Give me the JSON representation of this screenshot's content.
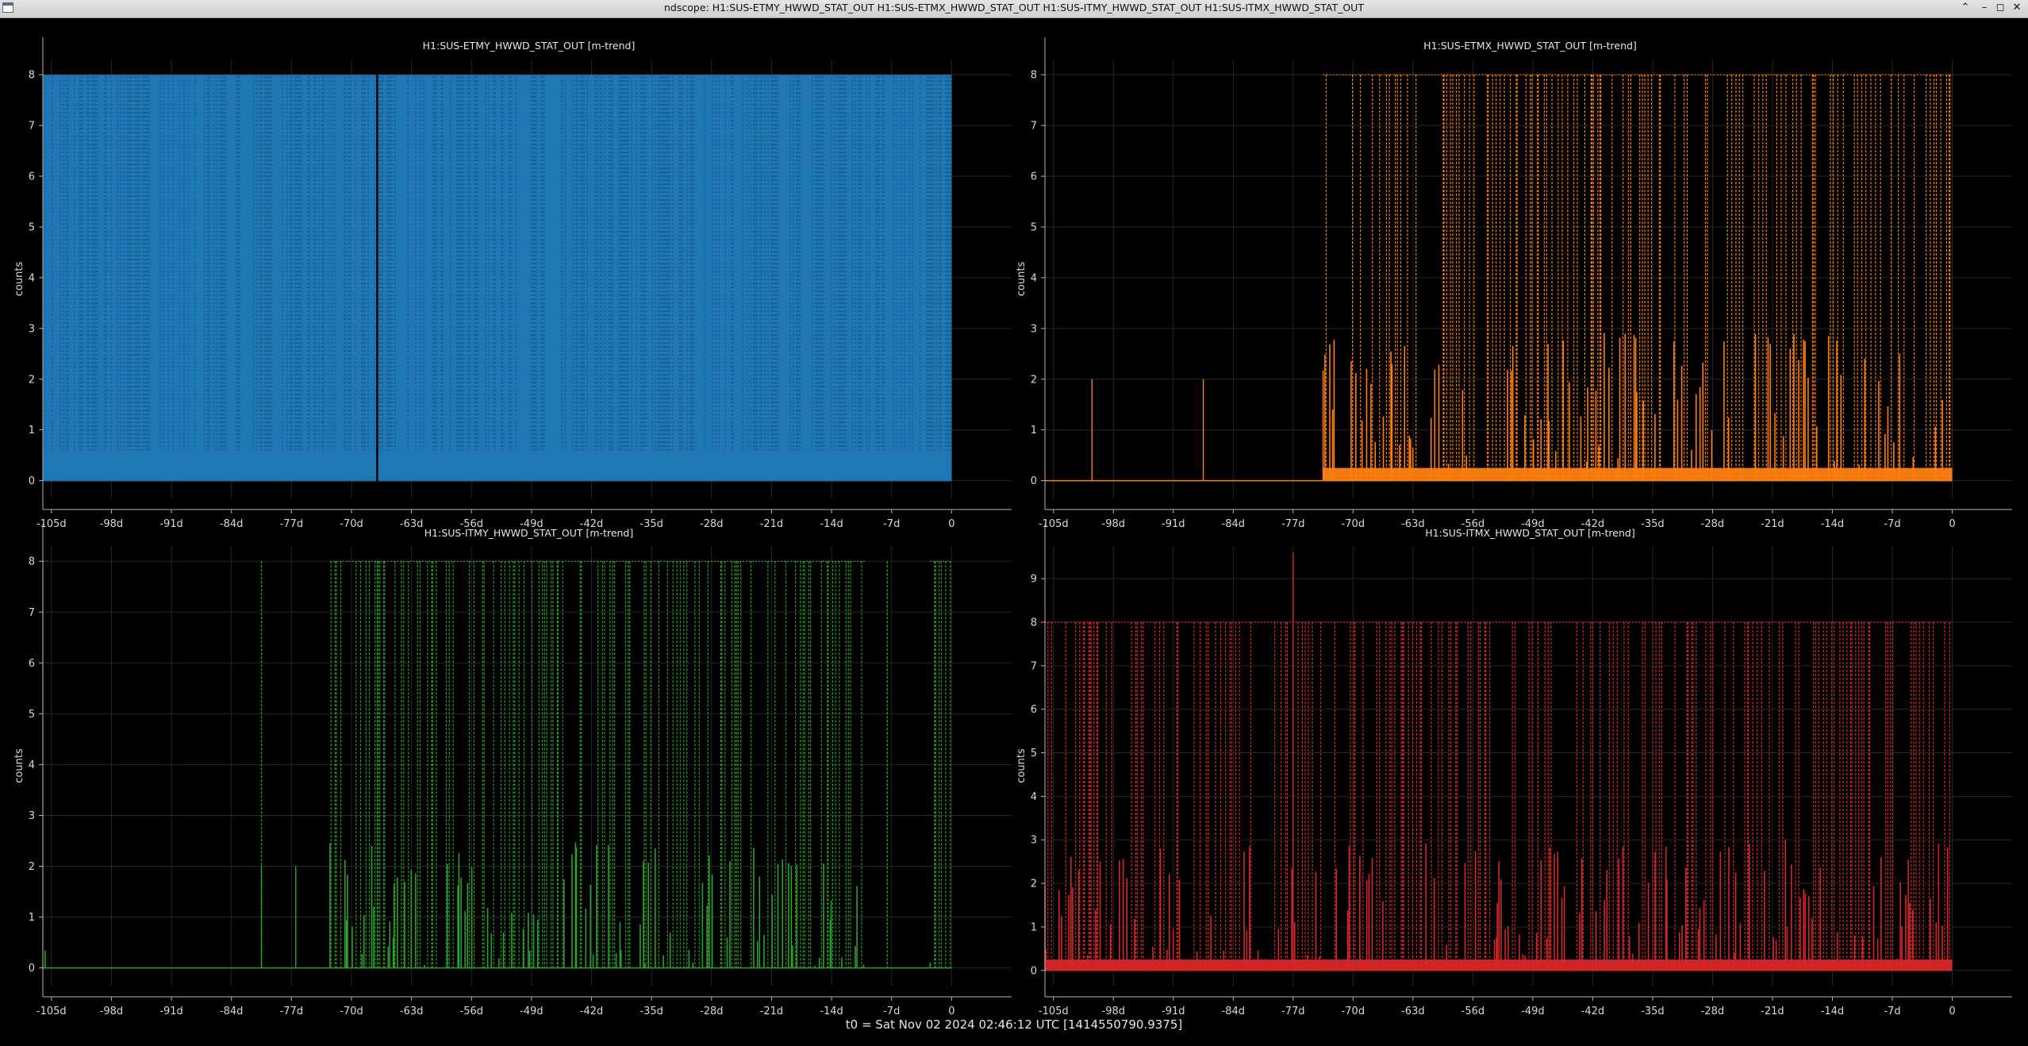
{
  "window": {
    "title": "ndscope: H1:SUS-ETMY_HWWD_STAT_OUT H1:SUS-ETMX_HWWD_STAT_OUT H1:SUS-ITMY_HWWD_STAT_OUT H1:SUS-ITMX_HWWD_STAT_OUT",
    "controls": {
      "maximize": "⌃",
      "minimize": "–",
      "restore": "◻",
      "close": "✕"
    }
  },
  "footer": {
    "t0_text": "t0 = Sat Nov 02 2024 02:46:12 UTC [1414550790.9375]"
  },
  "chart_data": [
    {
      "type": "line",
      "title": "H1:SUS-ETMY_HWWD_STAT_OUT [m-trend]",
      "ylabel": "counts",
      "xlabel": "",
      "color": "#1f77b4",
      "x_ticks": [
        "-105d",
        "-98d",
        "-91d",
        "-84d",
        "-77d",
        "-70d",
        "-63d",
        "-56d",
        "-49d",
        "-42d",
        "-35d",
        "-28d",
        "-21d",
        "-14d",
        "-7d",
        "0"
      ],
      "y_ticks": [
        "0",
        "1",
        "2",
        "3",
        "4",
        "5",
        "6",
        "7",
        "8"
      ],
      "xlim_days": [
        -106,
        7
      ],
      "ylim": [
        -0.35,
        8.3
      ],
      "grid": true,
      "max_level": 8,
      "active_ranges_days": [
        [
          -106,
          0
        ]
      ],
      "min_band_level": 0.6,
      "gaps_days": [
        -67
      ]
    },
    {
      "type": "line",
      "title": "H1:SUS-ETMX_HWWD_STAT_OUT [m-trend]",
      "ylabel": "counts",
      "xlabel": "",
      "color": "#ff7f0e",
      "x_ticks": [
        "-105d",
        "-98d",
        "-91d",
        "-84d",
        "-77d",
        "-70d",
        "-63d",
        "-56d",
        "-49d",
        "-42d",
        "-35d",
        "-28d",
        "-21d",
        "-14d",
        "-7d",
        "0"
      ],
      "y_ticks": [
        "0",
        "1",
        "2",
        "3",
        "4",
        "5",
        "6",
        "7",
        "8"
      ],
      "xlim_days": [
        -106,
        7
      ],
      "ylim": [
        -0.35,
        8.3
      ],
      "grid": true,
      "max_level": 8,
      "active_ranges_days": [
        [
          -73.5,
          0
        ]
      ],
      "min_band_level": 0.25,
      "spikes": [
        {
          "x_day": -100.5,
          "value": 2
        },
        {
          "x_day": -87.5,
          "value": 2
        }
      ]
    },
    {
      "type": "line",
      "title": "H1:SUS-ITMY_HWWD_STAT_OUT [m-trend]",
      "ylabel": "counts",
      "xlabel": "",
      "color": "#2ca02c",
      "x_ticks": [
        "-105d",
        "-98d",
        "-91d",
        "-84d",
        "-77d",
        "-70d",
        "-63d",
        "-56d",
        "-49d",
        "-42d",
        "-35d",
        "-28d",
        "-21d",
        "-14d",
        "-7d",
        "0"
      ],
      "y_ticks": [
        "0",
        "1",
        "2",
        "3",
        "4",
        "5",
        "6",
        "7",
        "8"
      ],
      "xlim_days": [
        -106,
        7
      ],
      "ylim": [
        -0.35,
        8.3
      ],
      "grid": true,
      "max_level": 8,
      "active_ranges_days": [
        [
          -106,
          -105.5
        ],
        [
          -72.5,
          -10
        ],
        [
          -2.5,
          0
        ]
      ],
      "spikes": [
        {
          "x_day": -80.5,
          "value": 8
        },
        {
          "x_day": -80.5,
          "value": 2
        },
        {
          "x_day": -76.5,
          "value": 2
        },
        {
          "x_day": -7.5,
          "value": 8
        }
      ]
    },
    {
      "type": "line",
      "title": "H1:SUS-ITMX_HWWD_STAT_OUT [m-trend]",
      "ylabel": "counts",
      "xlabel": "",
      "color": "#d62728",
      "x_ticks": [
        "-105d",
        "-98d",
        "-91d",
        "-84d",
        "-77d",
        "-70d",
        "-63d",
        "-56d",
        "-49d",
        "-42d",
        "-35d",
        "-28d",
        "-21d",
        "-14d",
        "-7d",
        "0"
      ],
      "y_ticks": [
        "0",
        "1",
        "2",
        "3",
        "4",
        "5",
        "6",
        "7",
        "8",
        "9"
      ],
      "xlim_days": [
        -106,
        7
      ],
      "ylim": [
        -0.35,
        9.75
      ],
      "grid": true,
      "max_level": 8,
      "active_ranges_days": [
        [
          -106,
          0
        ]
      ],
      "min_band_level": 0.25,
      "spikes": [
        {
          "x_day": -77,
          "value": 9.6
        }
      ]
    }
  ]
}
